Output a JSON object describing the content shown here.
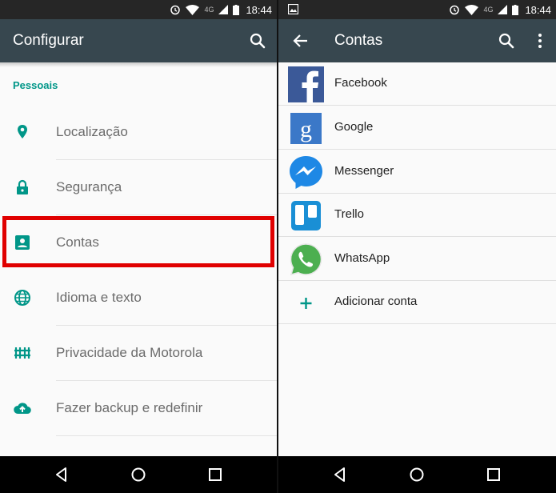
{
  "status": {
    "network": "4G",
    "time": "18:44"
  },
  "settings": {
    "title": "Configurar",
    "section": "Pessoais",
    "items": [
      {
        "label": "Localização",
        "icon": "location-icon"
      },
      {
        "label": "Segurança",
        "icon": "lock-icon"
      },
      {
        "label": "Contas",
        "icon": "account-icon"
      },
      {
        "label": "Idioma e texto",
        "icon": "globe-icon"
      },
      {
        "label": "Privacidade da Motorola",
        "icon": "privacy-icon"
      },
      {
        "label": "Fazer backup e redefinir",
        "icon": "cloud-upload-icon"
      }
    ]
  },
  "accounts": {
    "title": "Contas",
    "items": [
      {
        "label": "Facebook",
        "icon": "facebook-icon"
      },
      {
        "label": "Google",
        "icon": "google-icon"
      },
      {
        "label": "Messenger",
        "icon": "messenger-icon"
      },
      {
        "label": "Trello",
        "icon": "trello-icon"
      },
      {
        "label": "WhatsApp",
        "icon": "whatsapp-icon"
      }
    ],
    "add_label": "Adicionar conta"
  },
  "colors": {
    "appbar": "#37474f",
    "accent": "#009688",
    "highlight": "#e00000",
    "statusbar": "#262626"
  }
}
